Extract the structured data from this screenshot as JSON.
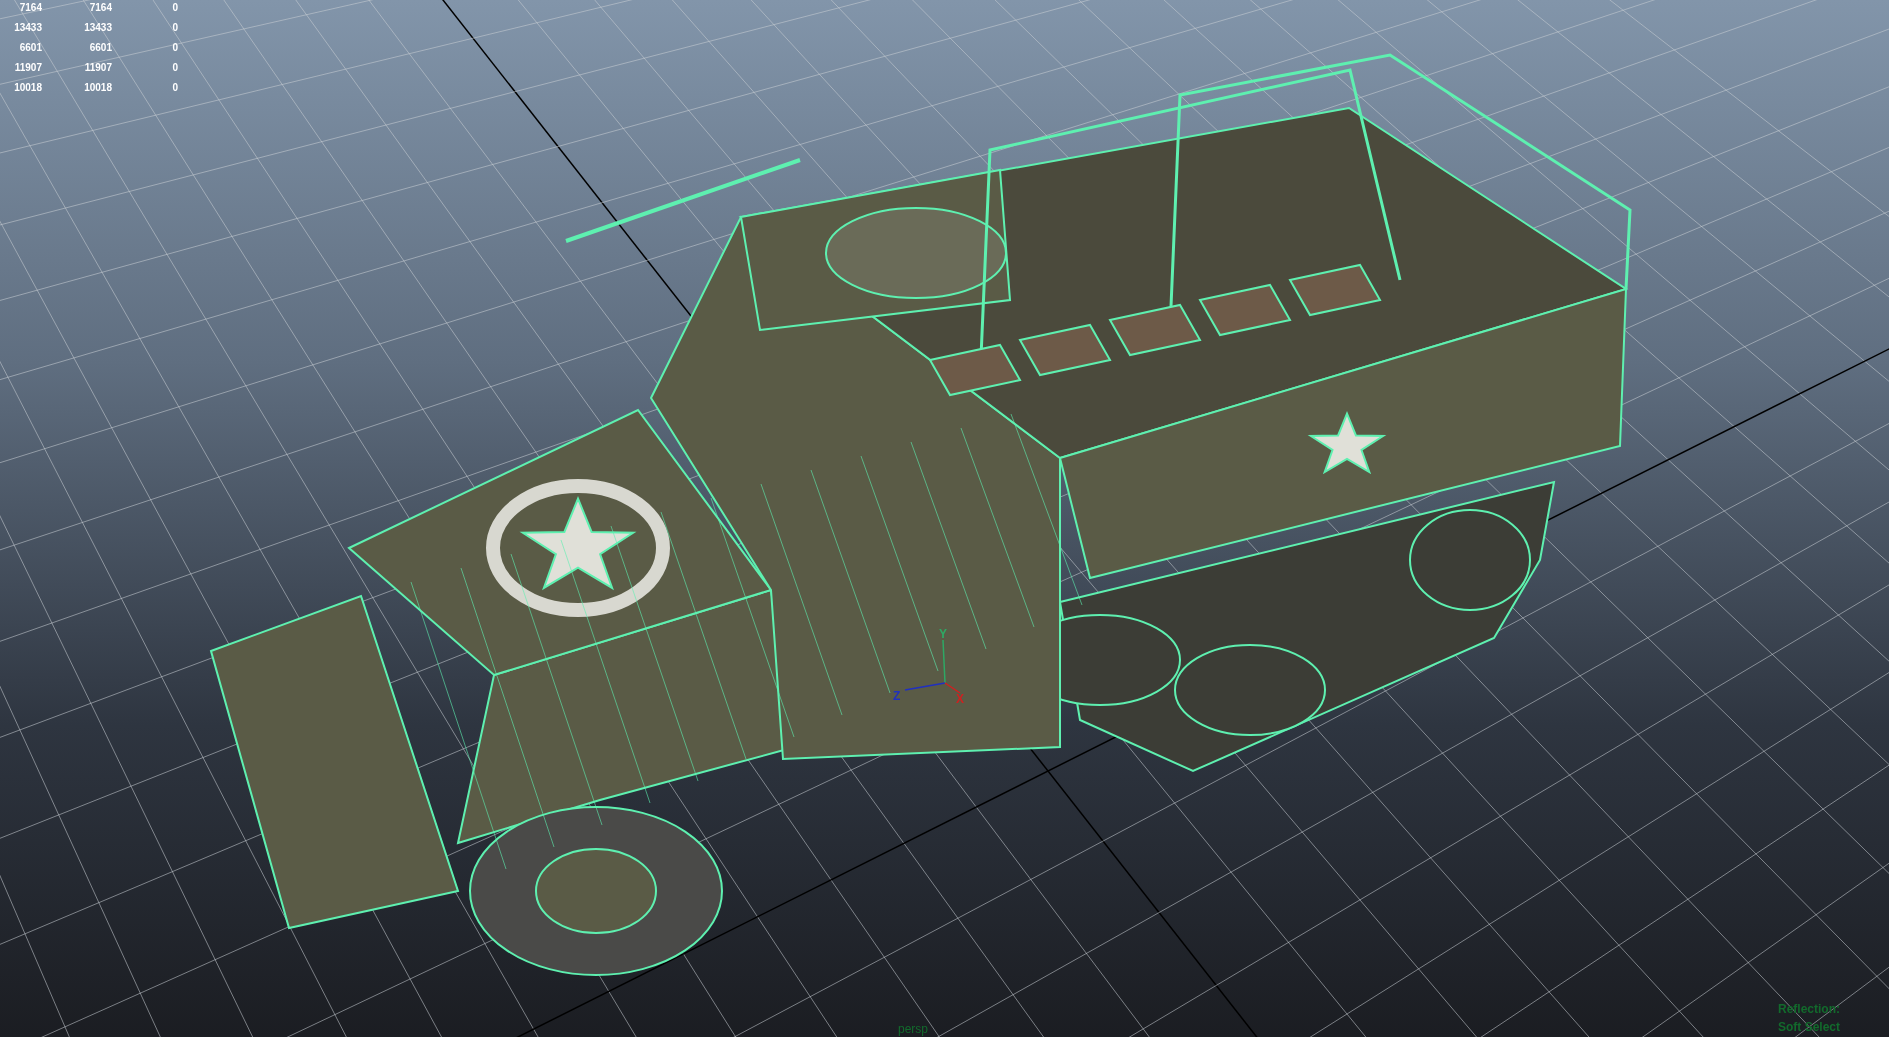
{
  "hud_stats": {
    "rows": [
      [
        "7164",
        "7164",
        "0"
      ],
      [
        "13433",
        "13433",
        "0"
      ],
      [
        "6601",
        "6601",
        "0"
      ],
      [
        "11907",
        "11907",
        "0"
      ],
      [
        "10018",
        "10018",
        "0"
      ]
    ]
  },
  "view_axes": [
    {
      "label": "Y",
      "color": "#2ea864"
    },
    {
      "label": "Z",
      "color": "#2030c0"
    },
    {
      "label": "X",
      "color": "#d02020"
    }
  ],
  "camera_label": "persp",
  "hud_notes": [
    "Reflection:",
    "Soft Select"
  ]
}
